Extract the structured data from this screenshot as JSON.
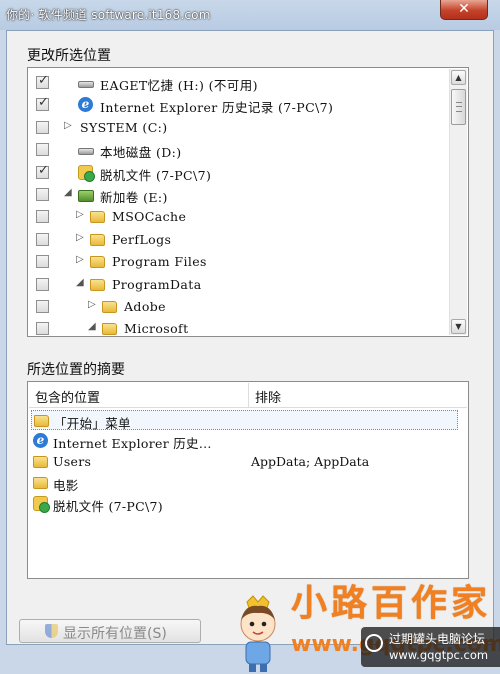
{
  "watermark_top": "你的· 软件频道 software.it168.com",
  "close_glyph": "✕",
  "section_change": {
    "title": "更改所选位置",
    "tree": [
      {
        "checked": true,
        "arrow": "",
        "indent": 0,
        "icon": "drive",
        "label": "EAGET忆捷 (H:) (不可用)"
      },
      {
        "checked": true,
        "arrow": "",
        "indent": 0,
        "icon": "ie",
        "label": "Internet Explorer 历史记录 (7-PC\\7)"
      },
      {
        "checked": false,
        "arrow": "▷",
        "indent": 0,
        "icon": "none",
        "label": "SYSTEM (C:)"
      },
      {
        "checked": false,
        "arrow": "",
        "indent": 0,
        "icon": "drive",
        "label": "本地磁盘 (D:)"
      },
      {
        "checked": true,
        "arrow": "",
        "indent": 0,
        "icon": "offline",
        "label": "脱机文件 (7-PC\\7)"
      },
      {
        "checked": false,
        "arrow": "◢",
        "indent": 0,
        "icon": "volume",
        "label": "新加卷 (E:)"
      },
      {
        "checked": false,
        "arrow": "▷",
        "indent": 1,
        "icon": "folder",
        "label": "MSOCache"
      },
      {
        "checked": false,
        "arrow": "▷",
        "indent": 1,
        "icon": "folder",
        "label": "PerfLogs"
      },
      {
        "checked": false,
        "arrow": "▷",
        "indent": 1,
        "icon": "folder",
        "label": "Program Files"
      },
      {
        "checked": false,
        "arrow": "◢",
        "indent": 1,
        "icon": "folder",
        "label": "ProgramData"
      },
      {
        "checked": false,
        "arrow": "▷",
        "indent": 2,
        "icon": "folder",
        "label": "Adobe"
      },
      {
        "checked": false,
        "arrow": "◢",
        "indent": 2,
        "icon": "folder",
        "label": "Microsoft"
      }
    ]
  },
  "section_summary": {
    "title": "所选位置的摘要",
    "col_included": "包含的位置",
    "col_excluded": "排除",
    "rows": [
      {
        "icon": "folder",
        "label": "「开始」菜单",
        "excluded": "",
        "selected": true
      },
      {
        "icon": "ie",
        "label": "Internet Explorer 历史...",
        "excluded": "",
        "selected": false
      },
      {
        "icon": "folder",
        "label": "Users",
        "excluded": "AppData; AppData",
        "selected": false
      },
      {
        "icon": "folder",
        "label": "电影",
        "excluded": "",
        "selected": false
      },
      {
        "icon": "offline",
        "label": "脱机文件 (7-PC\\7)",
        "excluded": "",
        "selected": false
      }
    ]
  },
  "show_all_button": "显示所有位置(S)",
  "logo": {
    "text": "小路百作家",
    "url": "www.gqgtpc.com",
    "badge_line1": "过期罐头电脑论坛",
    "badge_line2": "www.gqgtpc.com"
  }
}
